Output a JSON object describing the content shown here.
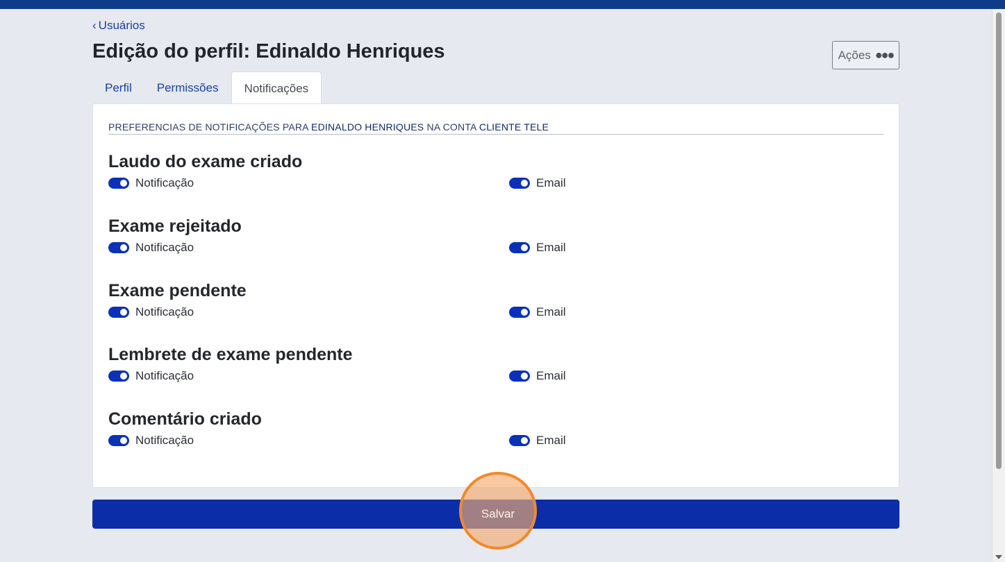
{
  "nav": {
    "back_label": "Usuários",
    "back_icon": "chevron-left-icon"
  },
  "page": {
    "title": "Edição do perfil: Edinaldo Henriques",
    "actions_label": "Ações",
    "actions_icon": "more-dots-icon"
  },
  "tabs": [
    {
      "label": "Perfil",
      "active": false
    },
    {
      "label": "Permissões",
      "active": false
    },
    {
      "label": "Notificações",
      "active": true
    }
  ],
  "preferences_header": {
    "prefix": "PREFERENCIAS DE NOTIFICAÇÕES PARA",
    "user": "EDINALDO HENRIQUES",
    "middle": "NA CONTA",
    "account": "CLIENTE TELE"
  },
  "sections": [
    {
      "title": "Laudo do exame criado",
      "notification_label": "Notificação",
      "notification_on": true,
      "email_label": "Email",
      "email_on": true
    },
    {
      "title": "Exame rejeitado",
      "notification_label": "Notificação",
      "notification_on": true,
      "email_label": "Email",
      "email_on": true
    },
    {
      "title": "Exame pendente",
      "notification_label": "Notificação",
      "notification_on": true,
      "email_label": "Email",
      "email_on": true
    },
    {
      "title": "Lembrete de exame pendente",
      "notification_label": "Notificação",
      "notification_on": true,
      "email_label": "Email",
      "email_on": true
    },
    {
      "title": "Comentário criado",
      "notification_label": "Notificação",
      "notification_on": true,
      "email_label": "Email",
      "email_on": true
    }
  ],
  "save_label": "Salvar",
  "colors": {
    "brand_blue": "#0b2ea8",
    "top_bar": "#0d3c8a",
    "toggle_on": "#0b31b8",
    "highlight": "#f08a2c",
    "background": "#e6e9ef"
  }
}
